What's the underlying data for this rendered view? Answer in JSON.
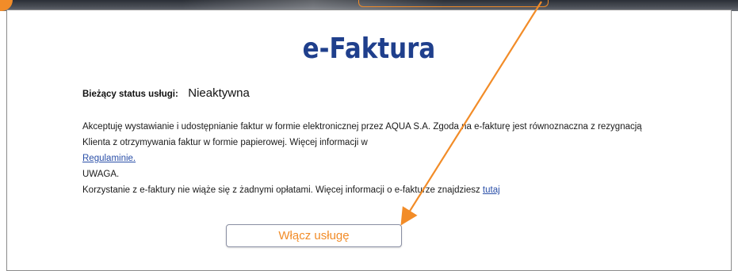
{
  "page": {
    "title": "e-Faktura"
  },
  "status": {
    "label": "Bieżący status usługi:",
    "value": "Nieaktywna"
  },
  "consent": {
    "text_before_link": "Akceptuję wystawianie i udostępnianie faktur w formie elektronicznej przez AQUA S.A. Zgoda na e-fakturę jest równoznaczna z rezygnacją Klienta z otrzymywania faktur w formie papierowej. Więcej informacji w ",
    "regulamin_link": "Regulaminie.",
    "warning_heading": "UWAGA.",
    "info_text": "Korzystanie z e-faktury nie wiąże się z żadnymi opłatami. Więcej informacji o e-fakturze znajdziesz ",
    "info_link": "tutaj"
  },
  "actions": {
    "enable_button_label": "Włącz usługę"
  },
  "colors": {
    "title": "#1f3f8c",
    "accent": "#f28c28",
    "link": "#2a4fa8"
  },
  "icons": [
    "step-number-badge-icon",
    "annotation-arrow-icon"
  ]
}
